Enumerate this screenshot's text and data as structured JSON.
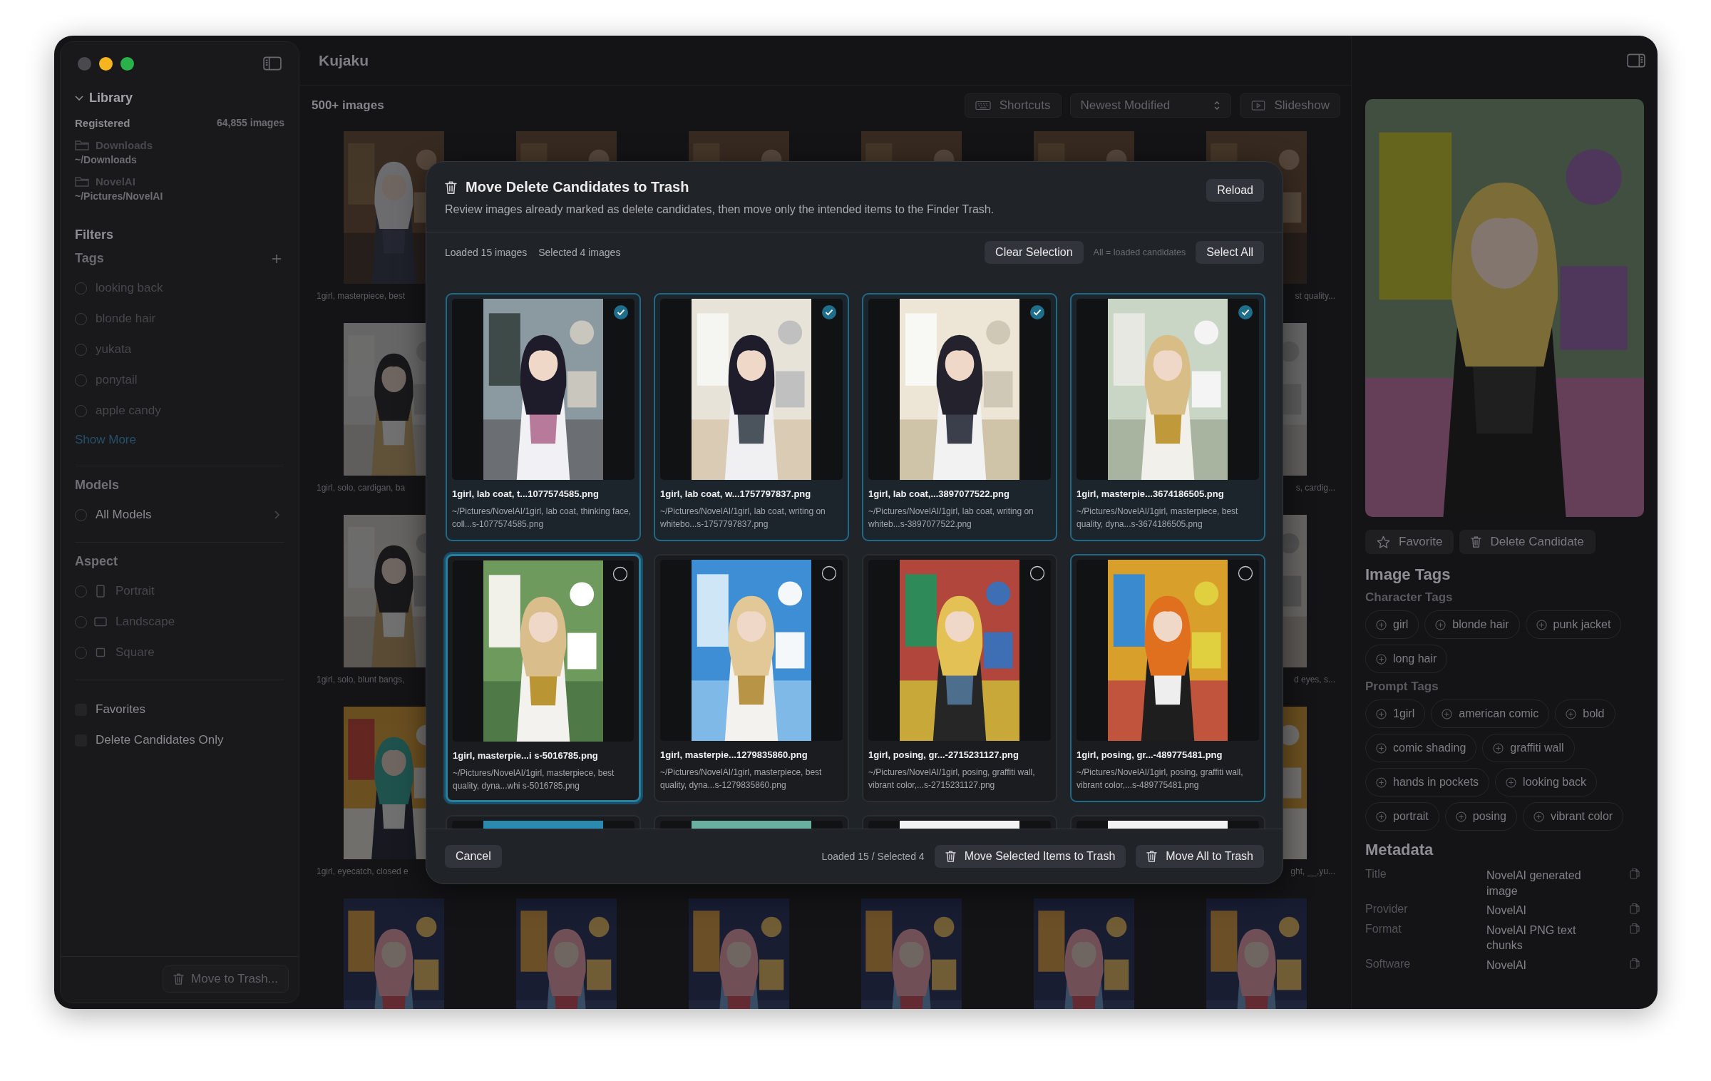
{
  "window": {
    "title": "Kujaku"
  },
  "sidebar": {
    "library": {
      "label": "Library",
      "expanded": true,
      "registered_label": "Registered",
      "count": "64,855 images",
      "folders": [
        {
          "name": "Downloads",
          "path": "~/Downloads"
        },
        {
          "name": "NovelAI",
          "path": "~/Pictures/NovelAI"
        }
      ]
    },
    "filters_label": "Filters",
    "tags": {
      "label": "Tags",
      "items": [
        {
          "label": "looking back",
          "selected": false
        },
        {
          "label": "blonde hair",
          "selected": false
        },
        {
          "label": "yukata",
          "selected": false
        },
        {
          "label": "ponytail",
          "selected": false
        },
        {
          "label": "apple candy",
          "selected": false
        }
      ],
      "show_more": "Show More"
    },
    "models": {
      "label": "Models",
      "items": [
        {
          "label": "All Models",
          "selected": false
        }
      ]
    },
    "aspect": {
      "label": "Aspect",
      "items": [
        {
          "label": "Portrait",
          "kind": "portrait",
          "selected": false
        },
        {
          "label": "Landscape",
          "kind": "landscape",
          "selected": false
        },
        {
          "label": "Square",
          "kind": "square",
          "selected": false
        }
      ]
    },
    "toggles": [
      {
        "label": "Favorites",
        "checked": false
      },
      {
        "label": "Delete Candidates Only",
        "checked": false
      }
    ],
    "move_button": "Move to Trash..."
  },
  "toolbar": {
    "count": "500+ images",
    "shortcuts": "Shortcuts",
    "sort": "Newest Modified",
    "slideshow": "Slideshow"
  },
  "gallery": {
    "rows": [
      [
        {
          "kind": "picture",
          "caption": "1girl, masterpiece, best"
        },
        {
          "kind": "picture"
        },
        {
          "kind": "picture"
        },
        {
          "kind": "picture"
        },
        {
          "kind": "picture"
        },
        {
          "kind": "picture",
          "caption": "st quality..."
        }
      ],
      [
        {
          "kind": "picture",
          "caption": "1girl, solo, cardigan, ba"
        },
        {
          "kind": "picture",
          "caption": "s, cardig..."
        }
      ],
      [
        {
          "kind": "picture",
          "caption": "1girl, solo, blunt bangs,"
        },
        {
          "kind": "picture",
          "caption": "d eyes, s..."
        }
      ],
      [
        {
          "kind": "picture",
          "caption": "1girl, eyecatch, closed e"
        },
        {
          "kind": "picture",
          "caption": "ght, __,yu..."
        }
      ],
      [
        {
          "kind": "picture"
        },
        {
          "kind": "picture"
        },
        {
          "kind": "picture"
        },
        {
          "kind": "picture"
        },
        {
          "kind": "picture"
        },
        {
          "kind": "picture"
        }
      ]
    ]
  },
  "modal": {
    "title": "Move Delete Candidates to Trash",
    "subtitle": "Review images already marked as delete candidates, then move only the intended items to the Finder Trash.",
    "reload": "Reload",
    "loaded": "Loaded 15 images",
    "selected_count": "Selected 4 images",
    "clear": "Clear Selection",
    "hint": "All = loaded candidates",
    "select_all": "Select All",
    "cards": [
      {
        "kind": "picture",
        "title": "1girl, lab coat, t...1077574585.png",
        "path": "~/Pictures/NovelAI/1girl, lab coat, thinking face, coll...s-1077574585.png",
        "selected": true,
        "focused": false,
        "hovered": false
      },
      {
        "kind": "picture",
        "title": "1girl, lab coat, w...1757797837.png",
        "path": "~/Pictures/NovelAI/1girl, lab coat, writing on whitebo...s-1757797837.png",
        "selected": true,
        "focused": false,
        "hovered": false
      },
      {
        "kind": "picture",
        "title": "1girl, lab coat,...3897077522.png",
        "path": "~/Pictures/NovelAI/1girl, lab coat, writing on whiteb...s-3897077522.png",
        "selected": true,
        "focused": false,
        "hovered": false
      },
      {
        "kind": "picture",
        "title": "1girl, masterpie...3674186505.png",
        "path": "~/Pictures/NovelAI/1girl, masterpiece, best quality, dyna...s-3674186505.png",
        "selected": true,
        "focused": false,
        "hovered": false
      },
      {
        "kind": "picture",
        "title": "1girl, masterpie...i s-5016785.png",
        "path": "~/Pictures/NovelAI/1girl, masterpiece, best quality, dyna...whi s-5016785.png",
        "selected": false,
        "focused": true,
        "hovered": false
      },
      {
        "kind": "picture",
        "title": "1girl, masterpie...1279835860.png",
        "path": "~/Pictures/NovelAI/1girl, masterpiece, best quality, dyna...s-1279835860.png",
        "selected": false,
        "focused": false,
        "hovered": false
      },
      {
        "kind": "picture",
        "title": "1girl, posing, gr...-2715231127.png",
        "path": "~/Pictures/NovelAI/1girl, posing, graffiti wall, vibrant color,...s-2715231127.png",
        "selected": false,
        "focused": false,
        "hovered": false
      },
      {
        "kind": "picture",
        "title": "1girl, posing, gr...-489775481.png",
        "path": "~/Pictures/NovelAI/1girl, posing, graffiti wall, vibrant color,...s-489775481.png",
        "selected": false,
        "focused": false,
        "hovered": true
      }
    ],
    "more_cards": [
      {
        "kind": "picture"
      },
      {
        "kind": "picture"
      },
      {
        "kind": "picture"
      },
      {
        "kind": "picture"
      }
    ],
    "cancel": "Cancel",
    "summary": "Loaded 15 / Selected 4",
    "move_selected": "Move Selected Items to Trash",
    "move_all": "Move All to Trash"
  },
  "inspector": {
    "preview": {
      "kind": "picture"
    },
    "favorite": "Favorite",
    "delete_candidate": "Delete Candidate",
    "image_tags_label": "Image Tags",
    "character_tags": {
      "label": "Character Tags",
      "items": [
        "girl",
        "blonde hair",
        "punk jacket",
        "long hair"
      ]
    },
    "prompt_tags": {
      "label": "Prompt Tags",
      "items": [
        "1girl",
        "american comic",
        "bold",
        "comic shading",
        "graffiti wall",
        "hands in pockets",
        "looking back",
        "portrait",
        "posing",
        "vibrant color"
      ]
    },
    "metadata": {
      "label": "Metadata",
      "rows": [
        {
          "key": "Title",
          "value": "NovelAI generated image"
        },
        {
          "key": "Provider",
          "value": "NovelAI"
        },
        {
          "key": "Format",
          "value": "NovelAI PNG text chunks"
        },
        {
          "key": "Software",
          "value": "NovelAI"
        }
      ]
    }
  }
}
